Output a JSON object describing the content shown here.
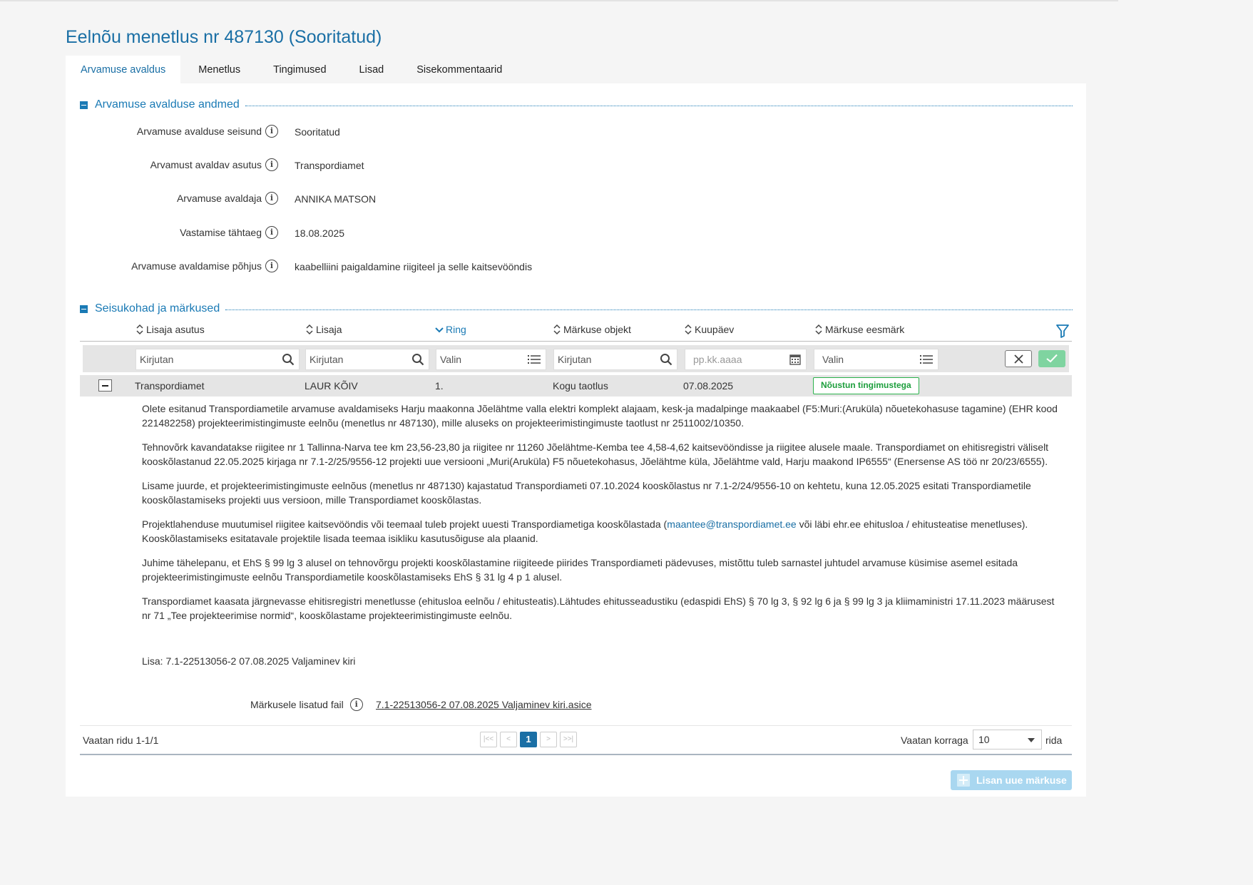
{
  "page": {
    "title": "Eelnõu menetlus nr 487130 (Sooritatud)"
  },
  "tabs": [
    {
      "label": "Arvamuse avaldus",
      "active": true
    },
    {
      "label": "Menetlus"
    },
    {
      "label": "Tingimused"
    },
    {
      "label": "Lisad"
    },
    {
      "label": "Sisekommentaarid"
    }
  ],
  "section1": {
    "title": "Arvamuse avalduse andmed",
    "fields": [
      {
        "label": "Arvamuse avalduse seisund",
        "value": "Sooritatud"
      },
      {
        "label": "Arvamust avaldav asutus",
        "value": "Transpordiamet"
      },
      {
        "label": "Arvamuse avaldaja",
        "value": "ANNIKA MATSON"
      },
      {
        "label": "Vastamise tähtaeg",
        "value": "18.08.2025"
      },
      {
        "label": "Arvamuse avaldamise põhjus",
        "value": "kaabelliini paigaldamine riigiteel ja selle kaitsevööndis"
      }
    ]
  },
  "section2": {
    "title": "Seisukohad ja märkused",
    "columns": [
      "Lisaja asutus",
      "Lisaja",
      "Ring",
      "Märkuse objekt",
      "Kuupäev",
      "Märkuse eesmärk"
    ],
    "filters": {
      "asutus": "Kirjutan",
      "lisaja": "Kirjutan",
      "ring": "Valin",
      "objekt": "Kirjutan",
      "kuupaev_placeholder": "pp.kk.aaaa",
      "eesmark": "Valin"
    },
    "row": {
      "asutus": "Transpordiamet",
      "lisaja": "LAUR KÕIV",
      "ring": "1.",
      "objekt": "Kogu taotlus",
      "kuupaev": "07.08.2025",
      "eesmark": "Nõustun tingimustega"
    },
    "detail": {
      "p1": "Olete esitanud Transpordiametile arvamuse avaldamiseks Harju maakonna Jõelähtme valla elektri komplekt alajaam, kesk-ja madalpinge maakaabel (F5:Muri:(Aruküla) nõuetekohasuse tagamine) (EHR kood 221482258) projekteerimistingimuste eelnõu (menetlus nr 487130), mille aluseks on projekteerimistingimuste taotlust nr 2511002/10350.",
      "p2": "Tehnovõrk kavandatakse riigitee nr 1 Tallinna-Narva tee km 23,56-23,80 ja riigitee nr 11260 Jõelähtme-Kemba tee 4,58-4,62 kaitsevööndisse ja riigitee alusele maale. Transpordiamet on ehitisregistri väliselt kooskõlastanud 22.05.2025 kirjaga nr 7.1-2/25/9556-12 projekti uue versiooni „Muri(Aruküla) F5 nõuetekohasus, Jõelähtme küla, Jõelähtme vald, Harju maakond IP6555“ (Enersense AS töö nr 20/23/6555).",
      "p3": "Lisame juurde, et projekteerimistingimuste eelnõus (menetlus nr 487130) kajastatud Transpordiameti 07.10.2024 kooskõlastus nr 7.1-2/24/9556-10 on kehtetu, kuna 12.05.2025 esitati Transpordiametile kooskõlastamiseks projekti uus versioon, mille Transpordiamet kooskõlastas.",
      "p4_before": "Projektlahenduse muutumisel riigitee kaitsevööndis või teemaal tuleb projekt uuesti Transpordiametiga kooskõlastada (",
      "p4_link": "maantee@transpordiamet.ee",
      "p4_after": " või läbi ehr.ee ehitusloa / ehitusteatise menetluses). Kooskõlastamiseks esitatavale projektile lisada teemaa isikliku kasutusõiguse ala plaanid.",
      "p5": "Juhime tähelepanu, et EhS § 99 lg 3 alusel on tehnovõrgu projekti kooskõlastamine riigiteede piirides Transpordiameti pädevuses, mistõttu tuleb sarnastel juhtudel arvamuse küsimise asemel esitada projekteerimistingimuste eelnõu Transpordiametile kooskõlastamiseks EhS § 31 lg 4 p 1 alusel.",
      "p6": "Transpordiamet kaasata järgnevasse ehitisregistri menetlusse (ehitusloa eelnõu / ehitusteatis).Lähtudes ehitusseadustiku (edaspidi EhS) § 70 lg 3, § 92 lg 6 ja § 99 lg 3 ja kliimaministri 17.11.2023 määrusest nr 71 „Tee projekteerimise normid“, kooskõlastame projekteerimistingimuste eelnõu.",
      "lisa": "Lisa: 7.1-22513056-2 07.08.2025 Valjaminev kiri",
      "file_label": "Märkusele lisatud fail",
      "file_link": "7.1-22513056-2 07.08.2025 Valjaminev kiri.asice"
    },
    "footer": {
      "rows_info": "Vaatan ridu 1-1/1",
      "current_page": "1",
      "per_page_label": "Vaatan korraga",
      "per_page_value": "10",
      "per_page_suffix": "rida",
      "add_button": "Lisan uue märkuse"
    }
  },
  "colors": {
    "accent": "#1a6fa5",
    "badge_green": "#2bb24c",
    "confirm_green": "#7fd4a0"
  }
}
